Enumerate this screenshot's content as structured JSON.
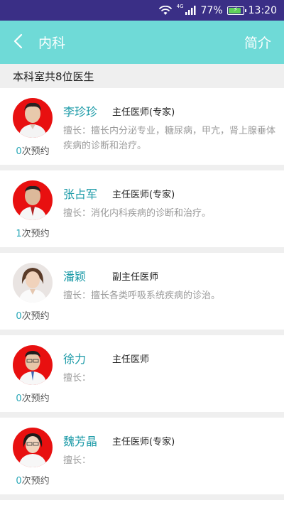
{
  "status_bar": {
    "network": "4G",
    "battery_percent": "77%",
    "battery_level": 0.77,
    "time": "13:20",
    "icons": [
      "wifi-icon",
      "signal-icon",
      "battery-icon"
    ]
  },
  "header": {
    "back_icon": "chevron-left-icon",
    "title": "内科",
    "intro_label": "简介"
  },
  "summary": {
    "count_text": "本科室共8位医生"
  },
  "doctors": [
    {
      "name": "李珍珍",
      "title": "主任医师(专家)",
      "skill": "擅长：擅长内分泌专业，糖尿病，甲亢，肾上腺垂体疾病的诊断和治疗。",
      "appointments": "0",
      "appointments_suffix": "次预约"
    },
    {
      "name": "张占军",
      "title": "主任医师(专家)",
      "skill": "擅长：消化内科疾病的诊断和治疗。",
      "appointments": "1",
      "appointments_suffix": "次预约"
    },
    {
      "name": "潘颖",
      "title": "副主任医师",
      "skill": "擅长：擅长各类呼吸系统疾病的诊治。",
      "appointments": "0",
      "appointments_suffix": "次预约"
    },
    {
      "name": "徐力",
      "title": "主任医师",
      "skill": "擅长：",
      "appointments": "0",
      "appointments_suffix": "次预约"
    },
    {
      "name": "魏芳晶",
      "title": "主任医师(专家)",
      "skill": "擅长：",
      "appointments": "0",
      "appointments_suffix": "次预约"
    }
  ],
  "colors": {
    "status_bar": "#3a2f86",
    "header": "#6fdad7",
    "name": "#1b9aa7",
    "avatar_bg": "#e81010"
  }
}
